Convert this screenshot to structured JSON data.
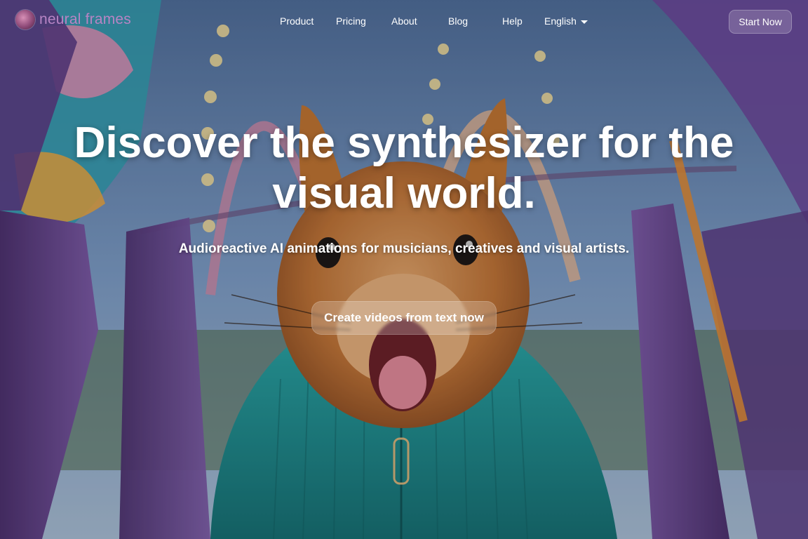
{
  "brand": {
    "name": "neural frames",
    "logo_icon": "squirrel-avatar-icon",
    "color": "#b784c4"
  },
  "nav": {
    "links": [
      {
        "label": "Product"
      },
      {
        "label": "Pricing"
      },
      {
        "label": "About"
      },
      {
        "label": "Blog"
      },
      {
        "label": "Help"
      }
    ],
    "language": {
      "selected": "English",
      "icon": "chevron-down-icon"
    },
    "start_label": "Start Now"
  },
  "hero": {
    "headline": "Discover the synthesizer for the visual world.",
    "subheadline": "Audioreactive AI animations for musicians, creatives and visual artists.",
    "cta_label": "Create videos from text now",
    "background": "squirrel-in-teal-sweater-on-purple-ride-image"
  },
  "colors": {
    "accent_purple": "#8a5fb3",
    "sweater_teal": "#1f9c9c",
    "sky_blue": "#8fb4dc"
  }
}
